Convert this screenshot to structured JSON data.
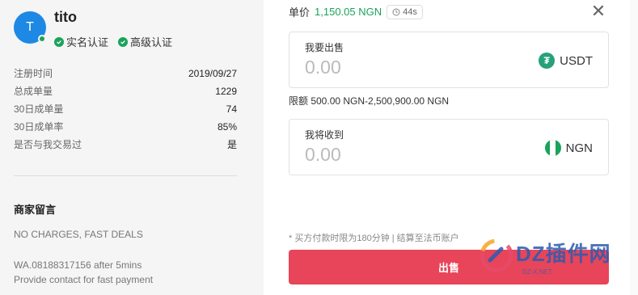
{
  "user": {
    "avatar_letter": "T",
    "name": "tito",
    "badges": [
      "实名认证",
      "高级认证"
    ]
  },
  "stats": [
    {
      "label": "注册时间",
      "value": "2019/09/27"
    },
    {
      "label": "总成单量",
      "value": "1229"
    },
    {
      "label": "30日成单量",
      "value": "74"
    },
    {
      "label": "30日成单率",
      "value": "85%"
    },
    {
      "label": "是否与我交易过",
      "value": "是"
    }
  ],
  "notes": {
    "title": "商家留言",
    "line1": "NO CHARGES, FAST DEALS",
    "line2": "WA.08188317156 after 5mins",
    "line3": "Provide contact for fast payment"
  },
  "order": {
    "price_label": "单价",
    "price_value": "1,150.05 NGN",
    "timer": "44s",
    "sell_label": "我要出售",
    "sell_placeholder": "0.00",
    "sell_currency": "USDT",
    "limit_text": "限额 500.00 NGN-2,500,900.00 NGN",
    "receive_label": "我将收到",
    "receive_placeholder": "0.00",
    "receive_currency": "NGN",
    "footnote": "* 买方付款时限为180分钟  |  结算至法币账户",
    "submit_label": "出售"
  },
  "colors": {
    "accent_green": "#1aa35a",
    "sell_button": "#e8455a",
    "avatar": "#1e88e5",
    "usdt": "#26a17b",
    "watermark": "#2a5cb0"
  },
  "watermark": {
    "text": "DZ插件网",
    "sub": "DZ-X.NET"
  }
}
